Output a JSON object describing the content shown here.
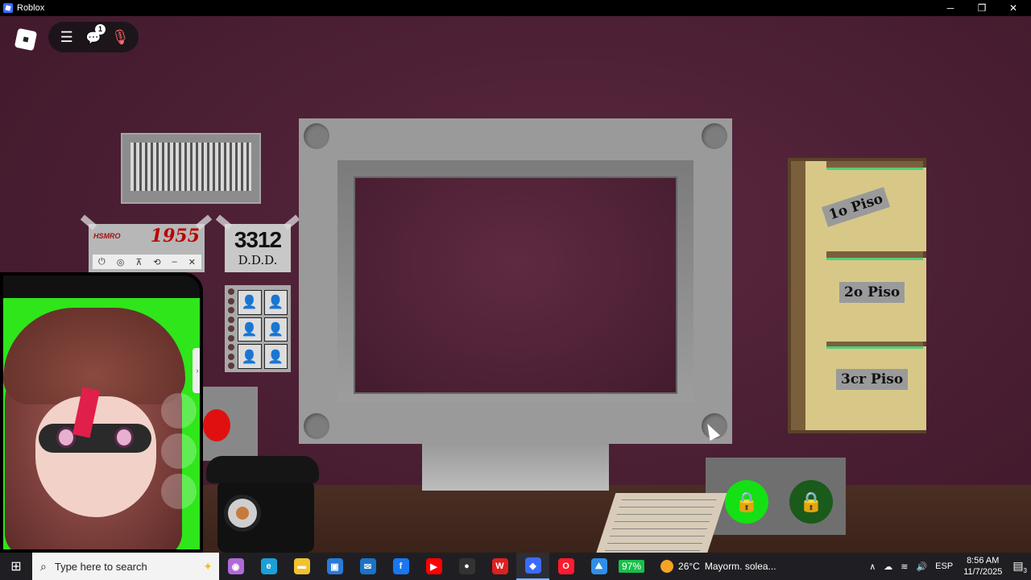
{
  "window": {
    "title": "Roblox",
    "minimize": "─",
    "restore": "❐",
    "close": "✕"
  },
  "hud": {
    "menu_icon": "☰",
    "chat_icon": "💬",
    "chat_badge": "1",
    "mic_icon": "🎙"
  },
  "room": {
    "calendar": {
      "small_text": "HSMRO",
      "year": "1955"
    },
    "number_sign": {
      "number": "3312",
      "subtitle": "D.D.D."
    },
    "folders": [
      {
        "label": "1o Piso"
      },
      {
        "label": "2o Piso"
      },
      {
        "label": "3cr Piso"
      }
    ],
    "lock_icon": "🔒"
  },
  "overlay_toolbar": {
    "power": "⏻",
    "record": "◎",
    "pin": "⊼",
    "history": "⟲",
    "minimize": "–",
    "close": "✕"
  },
  "vtuber": {
    "side_tab": "›"
  },
  "taskbar": {
    "start_icon": "⊞",
    "search_placeholder": "Type here to search",
    "battery": "97%",
    "weather_temp": "26°C",
    "weather_desc": "Mayorm. solea...",
    "language": "ESP",
    "time": "8:56 AM",
    "date": "11/7/2025",
    "notifications": "3",
    "apps": [
      {
        "name": "copilot",
        "glyph": "◉",
        "color": "#b06ad8"
      },
      {
        "name": "edge",
        "glyph": "e",
        "color": "#1aa0d8"
      },
      {
        "name": "file-explorer",
        "glyph": "▬",
        "color": "#f2c230"
      },
      {
        "name": "store",
        "glyph": "▣",
        "color": "#2a7ad8"
      },
      {
        "name": "outlook",
        "glyph": "✉",
        "color": "#1a73c8"
      },
      {
        "name": "facebook",
        "glyph": "f",
        "color": "#1877f2"
      },
      {
        "name": "youtube",
        "glyph": "▶",
        "color": "#ff0000"
      },
      {
        "name": "app-dark",
        "glyph": "●",
        "color": "#333333"
      },
      {
        "name": "wps",
        "glyph": "W",
        "color": "#e02020"
      },
      {
        "name": "roblox",
        "glyph": "◆",
        "color": "#3b6bff"
      },
      {
        "name": "opera",
        "glyph": "O",
        "color": "#ff1b2d"
      },
      {
        "name": "app-blue",
        "glyph": "⛰",
        "color": "#2f8fe8"
      }
    ]
  }
}
